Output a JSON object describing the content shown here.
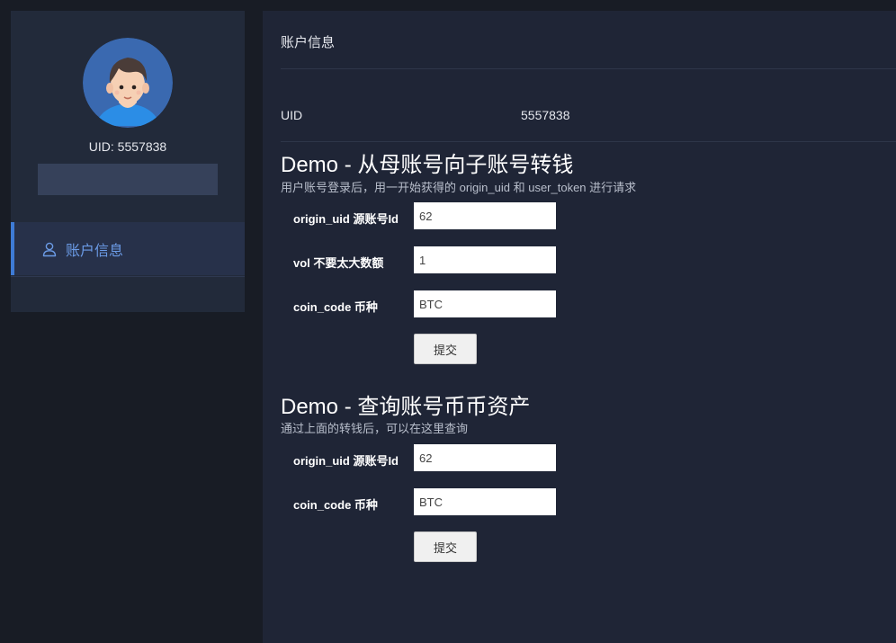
{
  "sidebar": {
    "uid_caption": "UID: 5557838",
    "nav": [
      {
        "label": "账户信息",
        "icon": "user-icon",
        "active": true
      }
    ]
  },
  "main": {
    "title": "账户信息",
    "uid_row": {
      "key": "UID",
      "value": "5557838"
    },
    "sections": [
      {
        "title": "Demo - 从母账号向子账号转钱",
        "desc": "用户账号登录后，用一开始获得的 origin_uid 和 user_token 进行请求",
        "fields": [
          {
            "label": "origin_uid 源账号Id",
            "value": "62"
          },
          {
            "label": "vol 不要太大数额",
            "value": "1"
          },
          {
            "label": "coin_code 币种",
            "value": "BTC"
          }
        ],
        "submit_label": "提交"
      },
      {
        "title": "Demo - 查询账号币币资产",
        "desc": "通过上面的转钱后，可以在这里查询",
        "fields": [
          {
            "label": "origin_uid 源账号Id",
            "value": "62"
          },
          {
            "label": "coin_code 币种",
            "value": "BTC"
          }
        ],
        "submit_label": "提交"
      }
    ]
  },
  "colors": {
    "page_bg": "#181c25",
    "sidebar_bg": "#222a3a",
    "main_bg": "#1f2536",
    "accent": "#3e7bd6",
    "nav_text": "#6b9be6"
  }
}
